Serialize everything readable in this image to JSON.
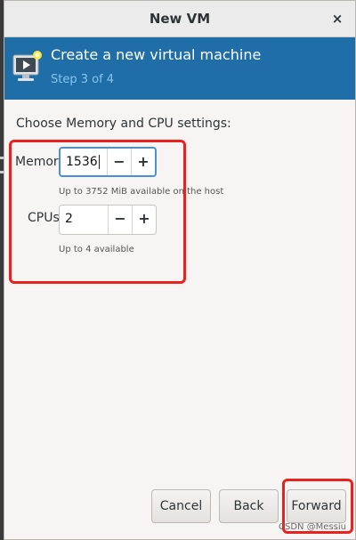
{
  "window": {
    "title": "New VM",
    "close_glyph": "×"
  },
  "banner": {
    "icon": "vm-monitor-icon",
    "title": "Create a new virtual machine",
    "step": "Step 3 of 4"
  },
  "settings": {
    "heading": "Choose Memory and CPU settings:",
    "memory": {
      "label": "Memory:",
      "value": "1536",
      "hint": "Up to 3752 MiB available on the host",
      "decrement": "−",
      "increment": "+"
    },
    "cpus": {
      "label": "CPUs:",
      "value": "2",
      "hint": "Up to 4 available",
      "decrement": "−",
      "increment": "+"
    }
  },
  "buttons": {
    "cancel": "Cancel",
    "back": "Back",
    "forward": "Forward"
  },
  "watermark": "CSDN @Messiu",
  "colors": {
    "banner": "#1f6ea8",
    "banner_step_text": "#86c5f1",
    "annotation": "#e8231f",
    "focus_ring": "#4a90d9"
  }
}
